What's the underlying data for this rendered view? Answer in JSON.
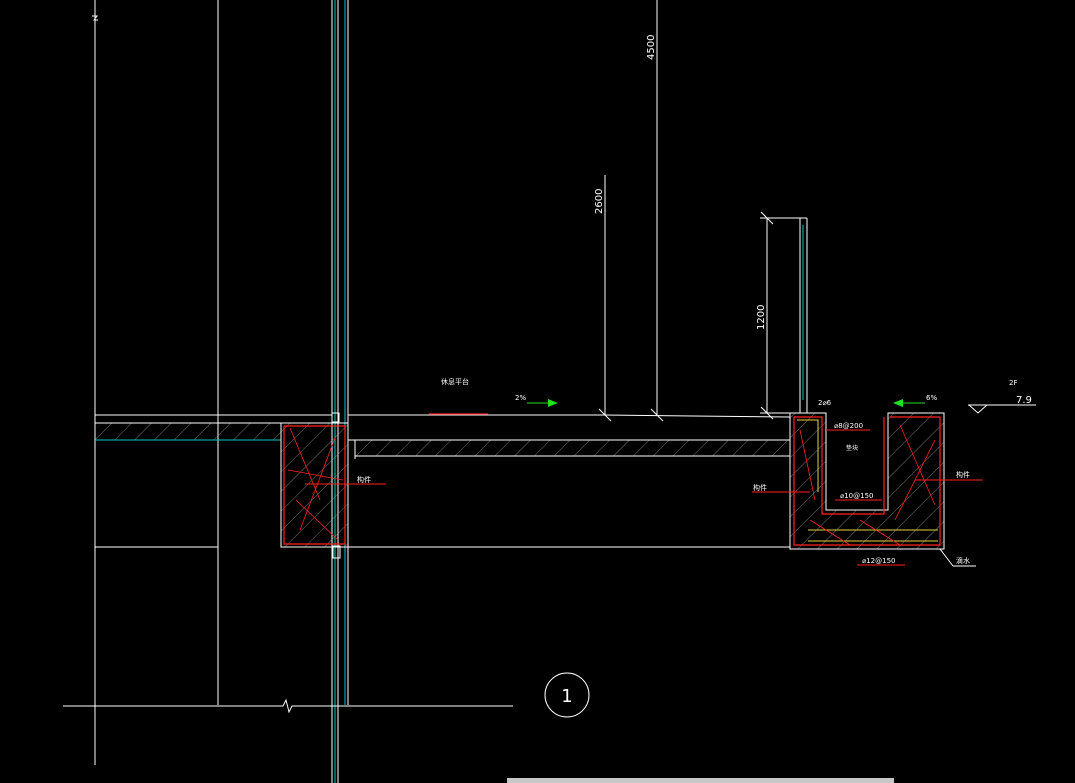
{
  "drawing": {
    "dims": {
      "d4500": "4500",
      "d2600": "2600",
      "d1200": "1200"
    },
    "slope_left": "2%",
    "slope_right": "6%",
    "platform_label": "休息平台",
    "floor": "2F",
    "elevation": "7.9",
    "note_2a6": "2⌀6",
    "rebar_top": "⌀8@200",
    "rebar_mid": "⌀10@150",
    "rebar_bottom": "⌀12@150",
    "note_mid": "垫块",
    "beam_label_left": "构件",
    "beam_label_trough_left": "构件",
    "beam_label_trough_right": "构件",
    "drain_label": "滴水",
    "detail_number": "1"
  },
  "colors": {
    "background": "#000000",
    "line": "#ffffff",
    "rebar": "#ff2020",
    "glass": "#00c8c8",
    "slope_arrow": "#20e020",
    "yellow": "#e8d040",
    "gray": "#c8c8c8"
  }
}
